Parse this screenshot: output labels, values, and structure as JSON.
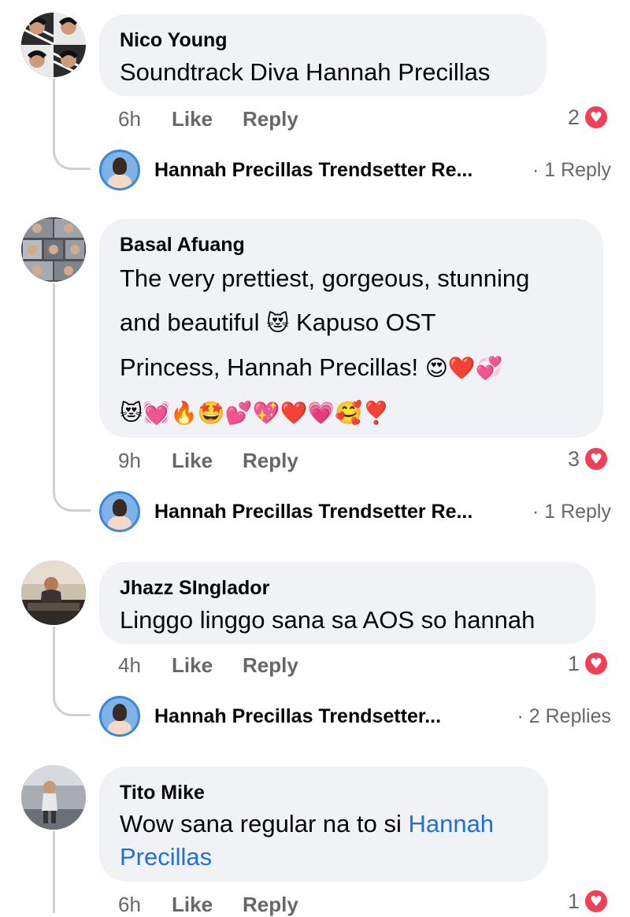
{
  "comments": [
    {
      "author": "Nico Young",
      "text": "Soundtrack Diva Hannah Precillas",
      "time": "6h",
      "like": "Like",
      "reply": "Reply",
      "reaction_count": "2",
      "replies": {
        "name": "Hannah Precillas Trendsetter Re...",
        "count": "· 1 Reply"
      }
    },
    {
      "author": "Basal Afuang",
      "text_line1": "The very prettiest, gorgeous, stunning",
      "text_line2a": "and beautiful",
      "emoji_cat": "😻",
      "text_line2b": "Kapuso OST",
      "text_line3": "Princess, Hannah Precillas!",
      "emoji_line3": "😍❤️💞",
      "emoji_line4": "😻💓🔥🤩💕💖❤️💗🥰❣️",
      "time": "9h",
      "like": "Like",
      "reply": "Reply",
      "reaction_count": "3",
      "replies": {
        "name": "Hannah Precillas Trendsetter Re...",
        "count": "· 1 Reply"
      }
    },
    {
      "author": "Jhazz SInglador",
      "text": "Linggo linggo sana sa AOS so hannah",
      "time": "4h",
      "like": "Like",
      "reply": "Reply",
      "reaction_count": "1",
      "replies": {
        "name": "Hannah Precillas Trendsetter...",
        "count": "· 2 Replies"
      }
    },
    {
      "author": "Tito Mike",
      "text_pre": "Wow sana regular na to si ",
      "text_link1": "Hannah",
      "text_link2": "Precillas",
      "time": "6h",
      "like": "Like",
      "reply": "Reply",
      "reaction_count": "1"
    }
  ],
  "icons": {
    "reaction": "heart-icon"
  },
  "colors": {
    "bubble": "#f0f2f5",
    "link": "#216fdb",
    "heart": "#f33e58",
    "meta": "#65676b"
  }
}
